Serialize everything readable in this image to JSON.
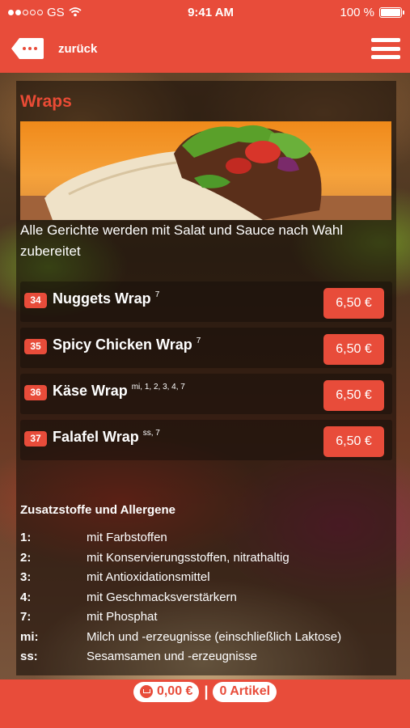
{
  "status_bar": {
    "carrier": "GS",
    "time": "9:41 AM",
    "battery": "100 %"
  },
  "nav": {
    "back_label": "zurück"
  },
  "section": {
    "title": "Wraps",
    "description": "Alle Gerichte werden mit Salat und Sauce nach Wahl zubereitet"
  },
  "items": [
    {
      "number": "34",
      "name": "Nuggets Wrap",
      "allergens": "7",
      "price": "6,50 €"
    },
    {
      "number": "35",
      "name": "Spicy Chicken Wrap",
      "allergens": "7",
      "price": "6,50 €"
    },
    {
      "number": "36",
      "name": "Käse Wrap",
      "allergens": "mi, 1, 2, 3, 4, 7",
      "price": "6,50 €"
    },
    {
      "number": "37",
      "name": "Falafel Wrap",
      "allergens": "ss, 7",
      "price": "6,50 €"
    }
  ],
  "allergens": {
    "title": "Zusatzstoffe und Allergene",
    "list": [
      {
        "code": "1:",
        "text": "mit Farbstoffen"
      },
      {
        "code": "2:",
        "text": "mit Konservierungsstoffen, nitrathaltig"
      },
      {
        "code": "3:",
        "text": "mit Antioxidationsmittel"
      },
      {
        "code": "4:",
        "text": "mit Geschmacksverstärkern"
      },
      {
        "code": "7:",
        "text": "mit Phosphat"
      },
      {
        "code": "mi:",
        "text": "Milch und -erzeugnisse (einschließlich Laktose)"
      },
      {
        "code": "ss:",
        "text": "Sesamsamen und -erzeugnisse"
      }
    ]
  },
  "footer": {
    "cart_total": "0,00 €",
    "separator": "|",
    "item_count": "0 Artikel"
  },
  "colors": {
    "accent": "#e84c3a",
    "text": "#ffffff"
  },
  "icons": {
    "signal": "signal-dots-icon",
    "wifi": "wifi-icon",
    "battery": "battery-icon",
    "back": "back-arrow-icon",
    "menu": "hamburger-menu-icon",
    "cart": "cart-icon"
  }
}
